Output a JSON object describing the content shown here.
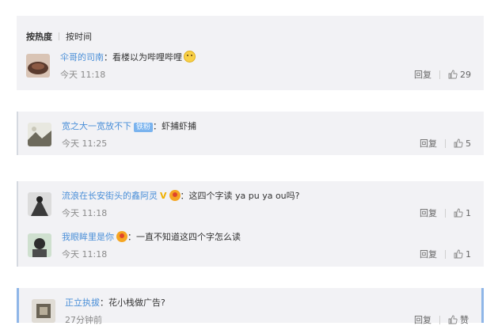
{
  "sort": {
    "hot_label": "按热度",
    "time_label": "按时间"
  },
  "comments": [
    {
      "user": "伞哥的司南",
      "text": "：看楼以为哔哩哔哩",
      "time": "今天 11:18",
      "reply": "回复",
      "likes": "29"
    },
    {
      "user": "宽之大一宽放不下",
      "tag": "铁粉",
      "text": "：虾捕虾捕",
      "time": "今天 11:25",
      "reply": "回复",
      "likes": "5"
    },
    {
      "user": "流浪在长安街头的鑫阿灵",
      "verified": "V",
      "text": "：这四个字读 ya pu ya ou吗?",
      "time": "今天 11:18",
      "reply": "回复",
      "likes": "1"
    },
    {
      "user": "我眼眸里是你",
      "text": "：一直不知道这四个字怎么读",
      "time": "今天 11:18",
      "reply": "回复",
      "likes": "1"
    },
    {
      "user": "正立执拔",
      "text": "：花小栈做广告?",
      "time": "27分钟前",
      "reply": "回复",
      "likes": "赞"
    }
  ]
}
